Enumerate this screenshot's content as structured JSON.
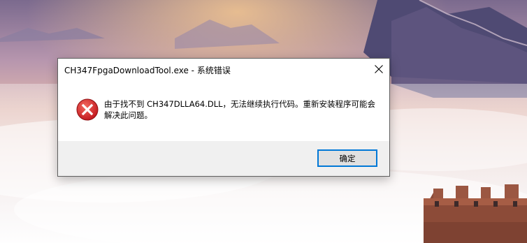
{
  "dialog": {
    "title": "CH347FpgaDownloadTool.exe - 系统错误",
    "message": "由于找不到 CH347DLLA64.DLL，无法继续执行代码。重新安装程序可能会解决此问题。",
    "ok_label": "确定"
  },
  "icons": {
    "close": "close-icon",
    "error": "error-icon"
  },
  "colors": {
    "error_red": "#d92121",
    "button_focus": "#0078d7",
    "footer_bg": "#f0f0f0"
  }
}
